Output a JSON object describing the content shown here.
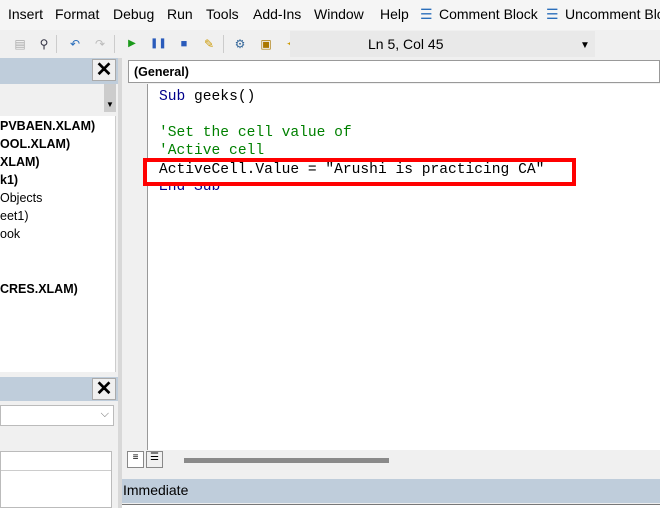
{
  "menu": [
    "Insert",
    "Format",
    "Debug",
    "Run",
    "Tools",
    "Add-Ins",
    "Window",
    "Help",
    "Comment Block",
    "Uncomment Block"
  ],
  "toolbar": {
    "status": "Ln 5, Col 45"
  },
  "project": {
    "items": [
      {
        "label": "PVBAEN.XLAM)",
        "bold": true
      },
      {
        "label": "OOL.XLAM)",
        "bold": true
      },
      {
        "label": "XLAM)",
        "bold": true
      },
      {
        "label": "k1)",
        "bold": true
      },
      {
        "label": "Objects",
        "bold": false
      },
      {
        "label": "eet1)",
        "bold": false
      },
      {
        "label": "ook",
        "bold": false
      },
      {
        "label": "CRES.XLAM)",
        "bold": true
      }
    ]
  },
  "code": {
    "object_dropdown": "(General)",
    "lines": [
      "Sub geeks()",
      "",
      "'Set the cell value of",
      "'Active cell",
      "ActiveCell.Value = \"Arushi is practicing CA\"",
      "End Sub"
    ],
    "highlight_color": "#ff0000"
  },
  "immediate": {
    "title": "Immediate"
  }
}
